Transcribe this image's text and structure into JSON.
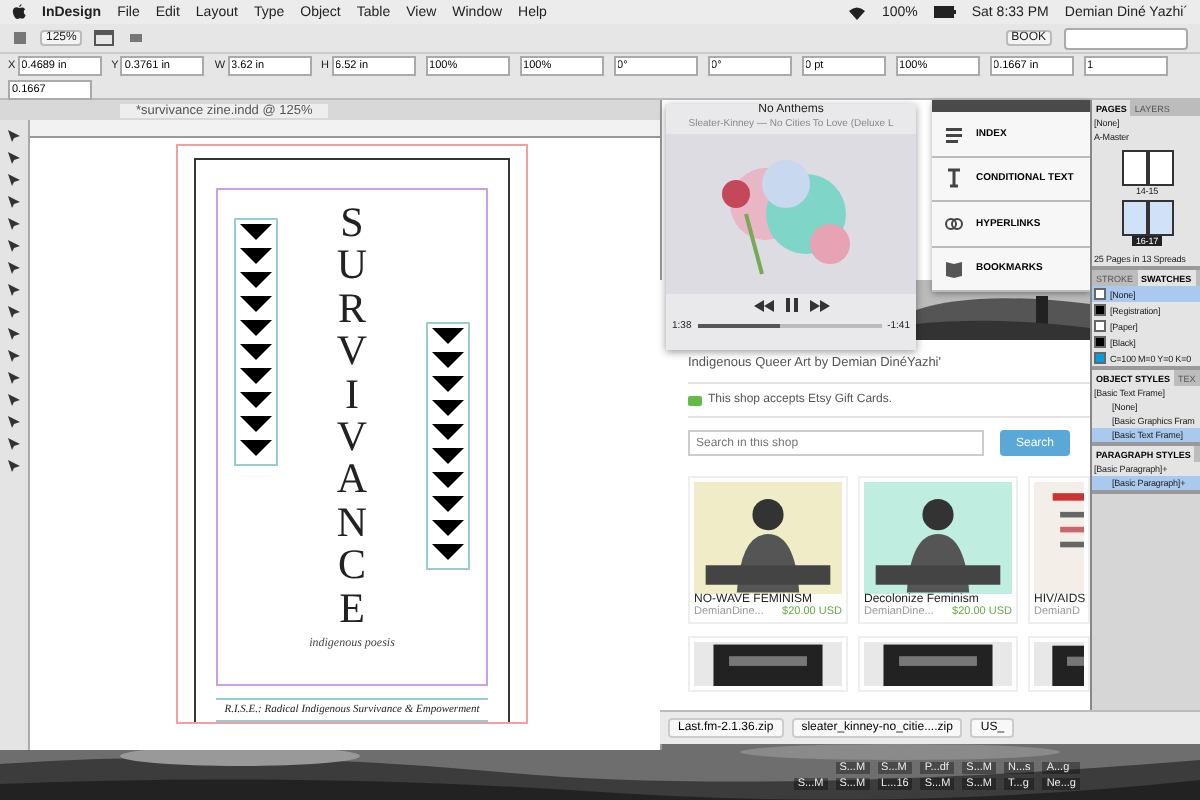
{
  "menubar": {
    "app": "InDesign",
    "menus": [
      "File",
      "Edit",
      "Layout",
      "Type",
      "Object",
      "Table",
      "View",
      "Window",
      "Help"
    ],
    "battery": "100%",
    "clock": "Sat 8:33 PM",
    "user": "Demian Diné Yazhi´"
  },
  "app_bar": {
    "zoom": "125%",
    "workspace": "BOOK"
  },
  "control_panel": {
    "fields": [
      {
        "label": "X",
        "value": "0.4689 in"
      },
      {
        "label": "Y",
        "value": "0.3761 in"
      },
      {
        "label": "W",
        "value": "3.62 in"
      },
      {
        "label": "H",
        "value": "6.52 in"
      },
      {
        "value": "100%"
      },
      {
        "value": "100%"
      },
      {
        "value": "0°"
      },
      {
        "value": "0°"
      },
      {
        "value": "0 pt"
      },
      {
        "value": "100%"
      },
      {
        "value": "0.1667 in"
      },
      {
        "value": "1"
      },
      {
        "value": "0.1667"
      }
    ]
  },
  "document": {
    "tab": "*survivance zine.indd @ 125%",
    "title": "SURVIVANCE",
    "subtitle": "indigenous poesis",
    "footer": "R.I.S.E.: Radical Indigenous Survivance & Empowerment"
  },
  "player": {
    "title": "No Anthems",
    "subtitle": "Sleater-Kinney — No Cities To Love (Deluxe L",
    "elapsed": "1:38",
    "remaining": "-1:41",
    "level": 0.45
  },
  "panel_menu": {
    "items": [
      {
        "label": "INDEX",
        "kind": "index"
      },
      {
        "label": "CONDITIONAL TEXT",
        "kind": "text"
      },
      {
        "label": "HYPERLINKS",
        "kind": "link"
      },
      {
        "label": "BOOKMARKS",
        "kind": "book"
      }
    ]
  },
  "shop": {
    "tagline": "Indigenous Queer Art by Demian DinéYazhi'",
    "gift": "This shop accepts Etsy Gift Cards.",
    "search": {
      "placeholder": "Search in this shop",
      "button": "Search"
    },
    "listings": [
      {
        "title": "NO-WAVE FEMINISM",
        "seller": "DemianDine...",
        "price": "$20.00",
        "currency": "USD"
      },
      {
        "title": "Decolonize Feminism",
        "seller": "DemianDine...",
        "price": "$20.00",
        "currency": "USD"
      },
      {
        "title": "HIV/AIDS",
        "seller": "DemianD"
      }
    ]
  },
  "downloads": [
    "Last.fm-2.1.36.zip",
    "sleater_kinney-no_citie....zip",
    "US_"
  ],
  "pages_panel": {
    "tabs": [
      {
        "label": "PAGES",
        "selected": true
      },
      {
        "label": "LAYERS",
        "selected": false
      }
    ],
    "items": [
      "[None]",
      "A-Master"
    ],
    "spreads": [
      {
        "label": "14-15",
        "selected": false
      },
      {
        "label": "16-17",
        "selected": true
      }
    ],
    "status": "25 Pages in 13 Spreads"
  },
  "swatches_panel": {
    "tabs": [
      {
        "label": "STROKE",
        "selected": false
      },
      {
        "label": "SWATCHES",
        "selected": true
      }
    ],
    "items": [
      {
        "label": "[None]",
        "color": "#ffffff",
        "selected": true
      },
      {
        "label": "[Registration]",
        "color": "#000000",
        "selected": false
      },
      {
        "label": "[Paper]",
        "color": "#ffffff",
        "selected": false
      },
      {
        "label": "[Black]",
        "color": "#000000",
        "selected": false
      },
      {
        "label": "C=100 M=0 Y=0 K=0",
        "color": "#00a0e0",
        "selected": false
      }
    ]
  },
  "object_styles": {
    "tabs": [
      {
        "label": "OBJECT STYLES",
        "selected": true
      },
      {
        "label": "TEX",
        "selected": false
      }
    ],
    "current": "[Basic Text Frame]",
    "items": [
      {
        "label": "[None]",
        "selected": false
      },
      {
        "label": "[Basic Graphics Fram",
        "selected": false
      },
      {
        "label": "[Basic Text Frame]",
        "selected": true
      }
    ]
  },
  "paragraph_styles": {
    "tabs": [
      {
        "label": "PARAGRAPH STYLES",
        "selected": true
      }
    ],
    "current": "[Basic Paragraph]+",
    "items": [
      {
        "label": "[Basic Paragraph]+",
        "selected": true
      }
    ]
  },
  "dock": {
    "items": [
      "S...M",
      "S...M",
      "P...df",
      "S...M",
      "N...s",
      "A...g",
      "S...M",
      "S...M",
      "L...16",
      "S...M",
      "S...M",
      "T...g",
      "Ne...g"
    ]
  }
}
